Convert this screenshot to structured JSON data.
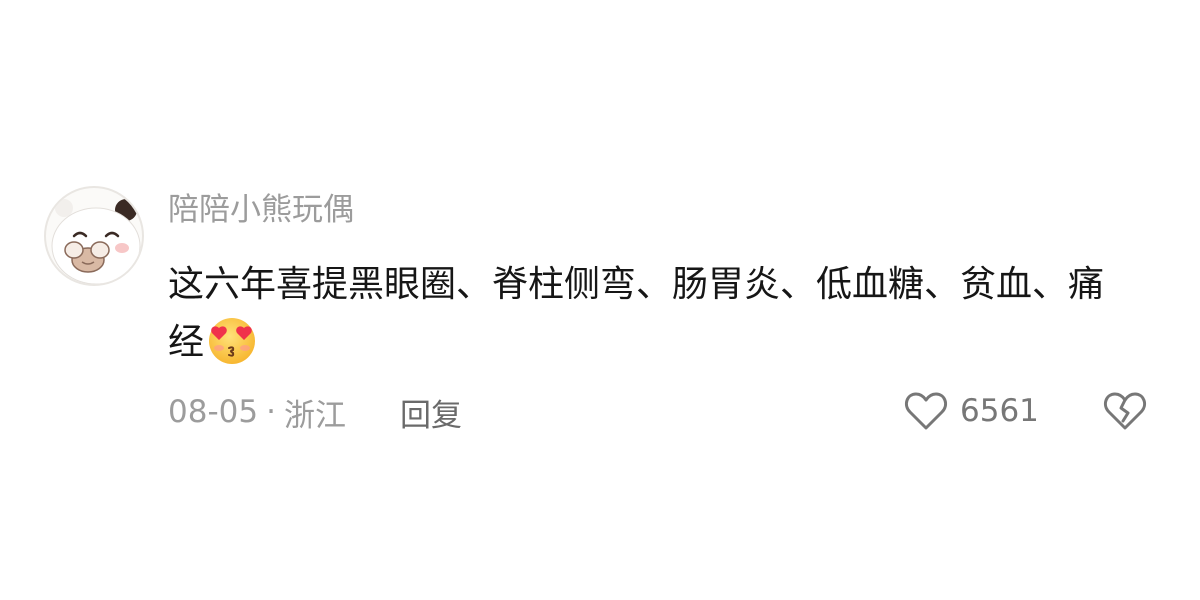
{
  "comment": {
    "username": "陪陪小熊玩偶",
    "text": "这六年喜提黑眼圈、脊柱侧弯、肠胃炎、低血糖、贫血、痛经",
    "emoji": "heart-eyes-kiss-emoji",
    "date": "08-05",
    "separator": "·",
    "location": "浙江",
    "reply_label": "回复",
    "like_count": "6561"
  },
  "icons": {
    "like": "heart-outline-icon",
    "dislike": "broken-heart-icon"
  },
  "colors": {
    "username": "#9c9c9c",
    "text": "#161616",
    "meta": "#9c9c9c",
    "icon": "#777777"
  }
}
